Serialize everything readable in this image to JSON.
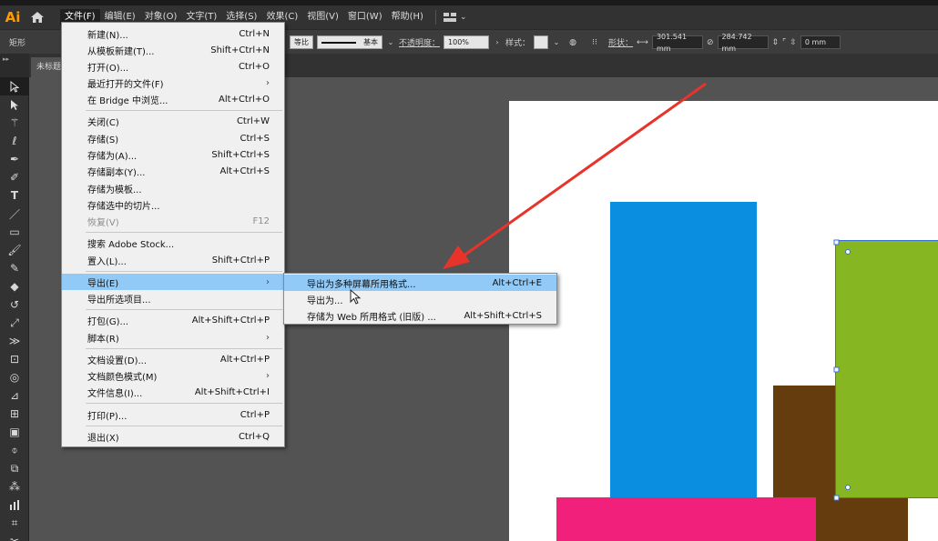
{
  "app": {
    "logo": "Ai",
    "menus": [
      "文件(F)",
      "编辑(E)",
      "对象(O)",
      "文字(T)",
      "选择(S)",
      "效果(C)",
      "视图(V)",
      "窗口(W)",
      "帮助(H)"
    ],
    "active_menu": "文件(F)"
  },
  "controlbar": {
    "selection_label": "矩形",
    "stroke_profile": "等比",
    "brush": "基本",
    "opacity_label": "不透明度：",
    "opacity_value": "100%",
    "style_label": "样式：",
    "shape_label": "形状：",
    "width_value": "301.541 mm",
    "height_value": "284.742 mm",
    "corner_value": "0 mm"
  },
  "tab": {
    "doc_name": "未标题"
  },
  "file_menu": {
    "items": [
      {
        "label": "新建(N)...",
        "shortcut": "Ctrl+N"
      },
      {
        "label": "从模板新建(T)...",
        "shortcut": "Shift+Ctrl+N"
      },
      {
        "label": "打开(O)...",
        "shortcut": "Ctrl+O"
      },
      {
        "label": "最近打开的文件(F)",
        "shortcut": "›"
      },
      {
        "label": "在 Bridge 中浏览...",
        "shortcut": "Alt+Ctrl+O"
      },
      {
        "label": "关闭(C)",
        "shortcut": "Ctrl+W"
      },
      {
        "label": "存储(S)",
        "shortcut": "Ctrl+S"
      },
      {
        "label": "存储为(A)...",
        "shortcut": "Shift+Ctrl+S"
      },
      {
        "label": "存储副本(Y)...",
        "shortcut": "Alt+Ctrl+S"
      },
      {
        "label": "存储为模板...",
        "shortcut": ""
      },
      {
        "label": "存储选中的切片...",
        "shortcut": ""
      },
      {
        "label": "恢复(V)",
        "shortcut": "F12"
      },
      {
        "label": "搜索 Adobe Stock...",
        "shortcut": ""
      },
      {
        "label": "置入(L)...",
        "shortcut": "Shift+Ctrl+P"
      },
      {
        "label": "导出(E)",
        "shortcut": "›"
      },
      {
        "label": "导出所选项目...",
        "shortcut": ""
      },
      {
        "label": "打包(G)...",
        "shortcut": "Alt+Shift+Ctrl+P"
      },
      {
        "label": "脚本(R)",
        "shortcut": "›"
      },
      {
        "label": "文档设置(D)...",
        "shortcut": "Alt+Ctrl+P"
      },
      {
        "label": "文档颜色模式(M)",
        "shortcut": "›"
      },
      {
        "label": "文件信息(I)...",
        "shortcut": "Alt+Shift+Ctrl+I"
      },
      {
        "label": "打印(P)...",
        "shortcut": "Ctrl+P"
      },
      {
        "label": "退出(X)",
        "shortcut": "Ctrl+Q"
      }
    ]
  },
  "export_submenu": {
    "items": [
      {
        "label": "导出为多种屏幕所用格式...",
        "shortcut": "Alt+Ctrl+E"
      },
      {
        "label": "导出为...",
        "shortcut": ""
      },
      {
        "label": "存储为 Web 所用格式 (旧版) ...",
        "shortcut": "Alt+Shift+Ctrl+S"
      }
    ]
  },
  "colors": {
    "blue_rect": "#0a8fe0",
    "green_rect": "#86b723",
    "brown_rect": "#643c0e",
    "pink_rect": "#f1207b",
    "arrow": "#e8332a",
    "menu_highlight": "#91c9f7"
  }
}
